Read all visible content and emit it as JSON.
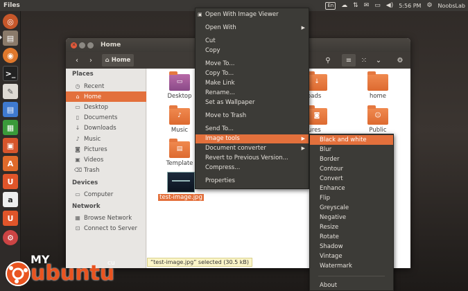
{
  "topbar": {
    "app_title": "Files",
    "keyboard_label": "En",
    "time": "5:56 PM",
    "user": "NoobsLab",
    "icons": [
      "keyboard-icon",
      "cloud-icon",
      "network-icon",
      "mail-icon",
      "battery-icon",
      "volume-icon",
      "gear-icon"
    ]
  },
  "launcher": {
    "items": [
      "dash-icon",
      "files-icon",
      "firefox-icon",
      "terminal-icon",
      "text-editor-icon",
      "writer-icon",
      "calc-icon",
      "impress-icon",
      "software-center-icon",
      "ubuntu-one-icon",
      "amazon-icon",
      "ubuntu-one-music-icon",
      "settings-icon"
    ]
  },
  "window": {
    "title": "Home",
    "location": "Home",
    "sidebar": {
      "places_heading": "Places",
      "places": [
        {
          "label": "Recent",
          "icon": "clock-icon"
        },
        {
          "label": "Home",
          "icon": "home-icon",
          "active": true
        },
        {
          "label": "Desktop",
          "icon": "desktop-icon"
        },
        {
          "label": "Documents",
          "icon": "document-icon"
        },
        {
          "label": "Downloads",
          "icon": "download-icon"
        },
        {
          "label": "Music",
          "icon": "music-icon"
        },
        {
          "label": "Pictures",
          "icon": "camera-icon"
        },
        {
          "label": "Videos",
          "icon": "video-icon"
        },
        {
          "label": "Trash",
          "icon": "trash-icon"
        }
      ],
      "devices_heading": "Devices",
      "devices": [
        {
          "label": "Computer",
          "icon": "computer-icon"
        }
      ],
      "network_heading": "Network",
      "network": [
        {
          "label": "Browse Network",
          "icon": "network-icon"
        },
        {
          "label": "Connect to Server",
          "icon": "server-icon"
        }
      ]
    },
    "files": [
      {
        "label": "Desktop",
        "icon": "folder-desktop-icon"
      },
      {
        "label": "loads",
        "icon": "folder-downloads-icon"
      },
      {
        "label": "home",
        "icon": "folder-icon"
      },
      {
        "label": "Music",
        "icon": "folder-music-icon"
      },
      {
        "label": "tures",
        "icon": "folder-pictures-icon"
      },
      {
        "label": "Public",
        "icon": "folder-public-icon"
      },
      {
        "label": "Template",
        "icon": "folder-templates-icon"
      },
      {
        "label": "test-image.jpg",
        "icon": "image-thumbnail-icon",
        "selected": true
      }
    ],
    "status": "“test-image.jpg” selected  (30.5 kB)"
  },
  "context_menu": {
    "items": [
      {
        "label": "Open With Image Viewer",
        "icon": "image-viewer-icon"
      },
      {
        "label": "Open With",
        "submenu": true
      },
      {
        "label": "Cut"
      },
      {
        "label": "Copy"
      },
      {
        "label": "Move To..."
      },
      {
        "label": "Copy To..."
      },
      {
        "label": "Make Link"
      },
      {
        "label": "Rename..."
      },
      {
        "label": "Set as Wallpaper"
      },
      {
        "label": "Move to Trash"
      },
      {
        "label": "Send To..."
      },
      {
        "label": "Image tools",
        "submenu": true,
        "highlighted": true
      },
      {
        "label": "Document converter",
        "submenu": true
      },
      {
        "label": "Revert to Previous Version..."
      },
      {
        "label": "Compress..."
      },
      {
        "label": "Properties"
      }
    ]
  },
  "submenu": {
    "items": [
      "Black and white",
      "Blur",
      "Border",
      "Contour",
      "Convert",
      "Enhance",
      "Flip",
      "Greyscale",
      "Negative",
      "Resize",
      "Rotate",
      "Shadow",
      "Vintage",
      "Watermark"
    ],
    "about": "About"
  },
  "watermark": {
    "line1": "MY",
    "line2": "ubuntu",
    "extra": "cu"
  },
  "colors": {
    "accent": "#e3703c",
    "menu_bg": "#3c3b37",
    "titlebar": "#3f3b37"
  }
}
